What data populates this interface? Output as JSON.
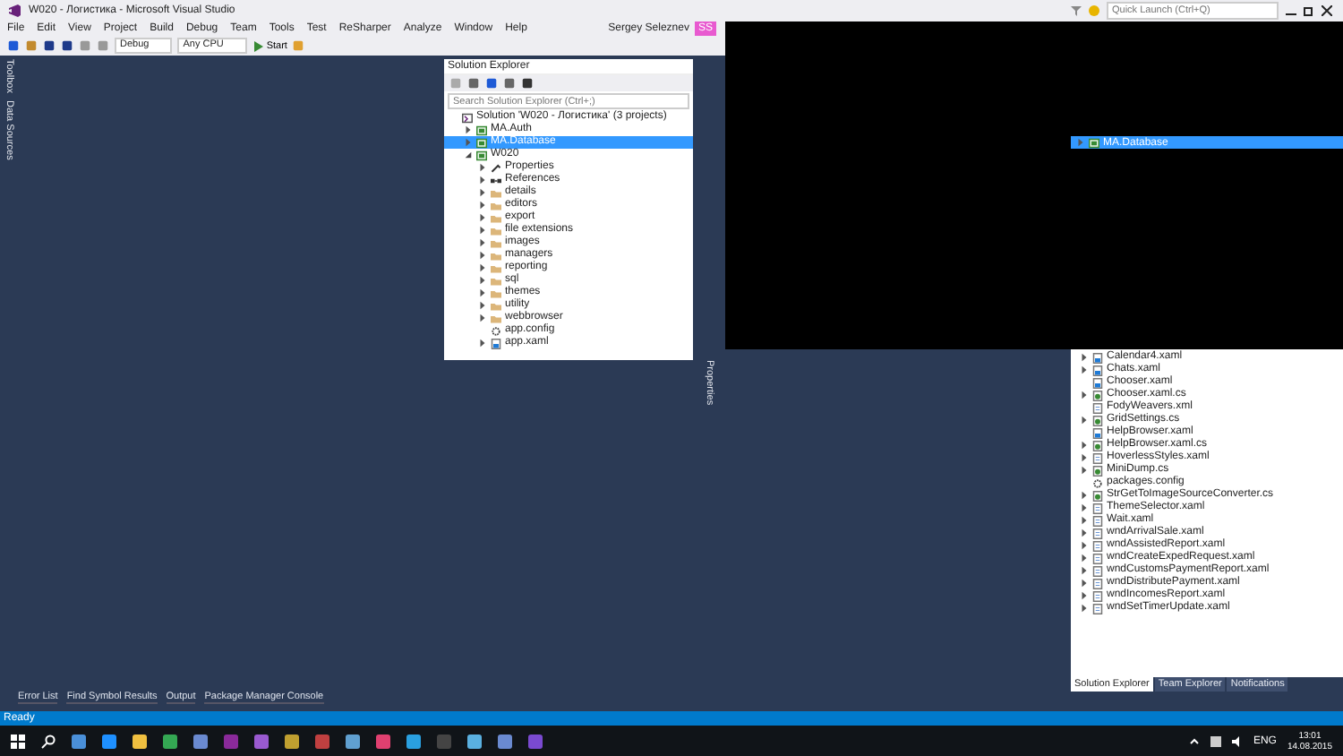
{
  "window": {
    "title": "W020 - Логистика - Microsoft Visual Studio"
  },
  "quick_launch": {
    "placeholder": "Quick Launch (Ctrl+Q)"
  },
  "menu": [
    "File",
    "Edit",
    "View",
    "Project",
    "Build",
    "Debug",
    "Team",
    "Tools",
    "Test",
    "ReSharper",
    "Analyze",
    "Window",
    "Help"
  ],
  "account": {
    "user": "Sergey Seleznev",
    "initials": "SS"
  },
  "toolbar": {
    "configuration": "Debug",
    "platform": "Any CPU",
    "start": "Start"
  },
  "left_tool_tabs": [
    "Toolbox",
    "Data Sources"
  ],
  "right_tool_tabs": [
    "Properties"
  ],
  "solution_explorer": {
    "title": "Solution Explorer",
    "search": {
      "placeholder": "Search Solution Explorer (Ctrl+;)"
    },
    "tree": [
      {
        "label": "Solution 'W020 - Логистика' (3 projects)",
        "kind": "solution",
        "selected": false,
        "children": [
          {
            "label": "MA.Auth",
            "kind": "project",
            "selected": false,
            "expanded": false
          },
          {
            "label": "MA.Database",
            "kind": "project",
            "selected": true,
            "expanded": false
          },
          {
            "label": "W020",
            "kind": "project",
            "selected": false,
            "expanded": true,
            "children": [
              {
                "label": "Properties",
                "kind": "properties",
                "selected": false,
                "expanded": false
              },
              {
                "label": "References",
                "kind": "references",
                "selected": false,
                "expanded": false
              },
              {
                "label": "details",
                "kind": "folder",
                "selected": false,
                "expanded": false
              },
              {
                "label": "editors",
                "kind": "folder",
                "selected": false,
                "expanded": false
              },
              {
                "label": "export",
                "kind": "folder",
                "selected": false,
                "expanded": false
              },
              {
                "label": "file extensions",
                "kind": "folder",
                "selected": false,
                "expanded": false
              },
              {
                "label": "images",
                "kind": "folder",
                "selected": false,
                "expanded": false
              },
              {
                "label": "managers",
                "kind": "folder",
                "selected": false,
                "expanded": false
              },
              {
                "label": "reporting",
                "kind": "folder",
                "selected": false,
                "expanded": false
              },
              {
                "label": "sql",
                "kind": "folder",
                "selected": false,
                "expanded": false
              },
              {
                "label": "themes",
                "kind": "folder",
                "selected": false,
                "expanded": false
              },
              {
                "label": "utility",
                "kind": "folder",
                "selected": false,
                "expanded": false
              },
              {
                "label": "webbrowser",
                "kind": "folder",
                "selected": false,
                "expanded": false
              },
              {
                "label": "app.config",
                "kind": "config",
                "selected": false
              },
              {
                "label": "app.xaml",
                "kind": "xaml",
                "selected": false,
                "expanded": false
              }
            ]
          }
        ]
      }
    ]
  },
  "overlay": {
    "selected_row": "MA.Database"
  },
  "file_list": [
    {
      "label": "Calendar4.xaml",
      "kind": "xaml",
      "expandable": true
    },
    {
      "label": "Chats.xaml",
      "kind": "xaml",
      "expandable": true
    },
    {
      "label": "Chooser.xaml",
      "kind": "xaml",
      "expandable": false
    },
    {
      "label": "Chooser.xaml.cs",
      "kind": "cs",
      "expandable": true
    },
    {
      "label": "FodyWeavers.xml",
      "kind": "file",
      "expandable": false
    },
    {
      "label": "GridSettings.cs",
      "kind": "cs",
      "expandable": true
    },
    {
      "label": "HelpBrowser.xaml",
      "kind": "xaml",
      "expandable": false
    },
    {
      "label": "HelpBrowser.xaml.cs",
      "kind": "cs",
      "expandable": true
    },
    {
      "label": "HoverlessStyles.xaml",
      "kind": "file",
      "expandable": true
    },
    {
      "label": "MiniDump.cs",
      "kind": "cs",
      "expandable": true
    },
    {
      "label": "packages.config",
      "kind": "config",
      "expandable": false
    },
    {
      "label": "StrGetToImageSourceConverter.cs",
      "kind": "cs",
      "expandable": true
    },
    {
      "label": "ThemeSelector.xaml",
      "kind": "file",
      "expandable": true
    },
    {
      "label": "Wait.xaml",
      "kind": "file",
      "expandable": true
    },
    {
      "label": "wndArrivalSale.xaml",
      "kind": "file",
      "expandable": true
    },
    {
      "label": "wndAssistedReport.xaml",
      "kind": "file",
      "expandable": true
    },
    {
      "label": "wndCreateExpedRequest.xaml",
      "kind": "file",
      "expandable": true
    },
    {
      "label": "wndCustomsPaymentReport.xaml",
      "kind": "file",
      "expandable": true
    },
    {
      "label": "wndDistributePayment.xaml",
      "kind": "file",
      "expandable": true
    },
    {
      "label": "wndIncomesReport.xaml",
      "kind": "file",
      "expandable": true
    },
    {
      "label": "wndSetTimerUpdate.xaml",
      "kind": "file",
      "expandable": true
    }
  ],
  "explorer_tabs": [
    {
      "label": "Solution Explorer",
      "selected": true
    },
    {
      "label": "Team Explorer",
      "selected": false
    },
    {
      "label": "Notifications",
      "selected": false
    }
  ],
  "bottom_tabs": [
    "Error List",
    "Find Symbol Results",
    "Output",
    "Package Manager Console"
  ],
  "status_bar": {
    "text": "Ready"
  },
  "taskbar": {
    "language": "ENG",
    "time": "13:01",
    "date": "14.08.2015"
  }
}
